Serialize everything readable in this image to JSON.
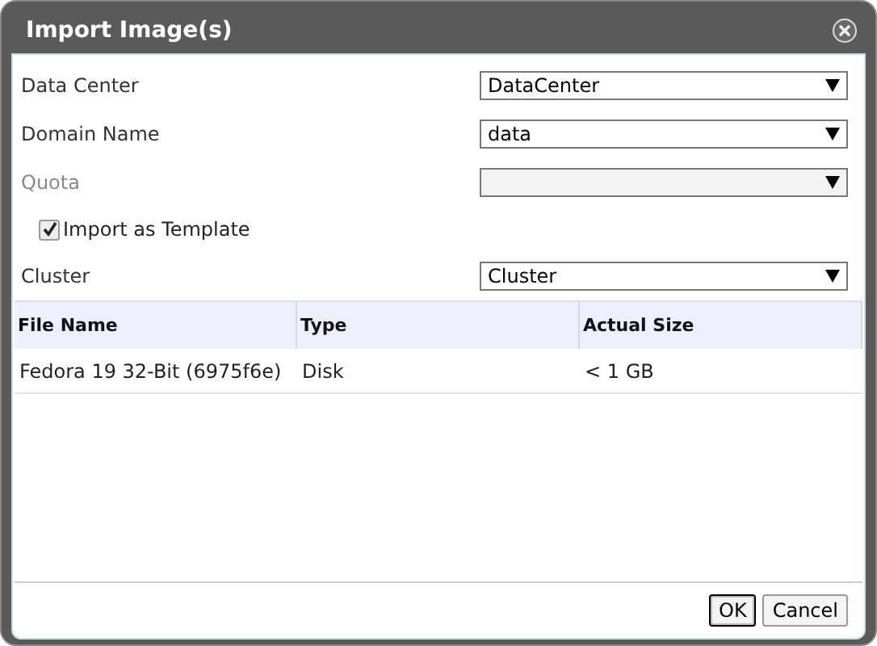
{
  "window": {
    "title": "Import Image(s)"
  },
  "fields": [
    {
      "label": "Data Center",
      "value": "DataCenter",
      "disabled": false
    },
    {
      "label": "Domain Name",
      "value": "data",
      "disabled": false
    },
    {
      "label": "Quota",
      "disabled": true
    }
  ],
  "import_as_template": {
    "label": "Import as Template",
    "checked": true
  },
  "cluster": {
    "label": "Cluster",
    "value": "Cluster",
    "disabled": false
  },
  "table": {
    "columns": [
      "File Name",
      "Type",
      "Actual Size"
    ],
    "rows": [
      [
        "Fedora 19 32-Bit (6975f6e)",
        "Disk",
        "< 1 GB"
      ]
    ]
  },
  "buttons": [
    {
      "label": "OK",
      "focused": true
    },
    {
      "label": "Cancel",
      "focused": false
    }
  ]
}
